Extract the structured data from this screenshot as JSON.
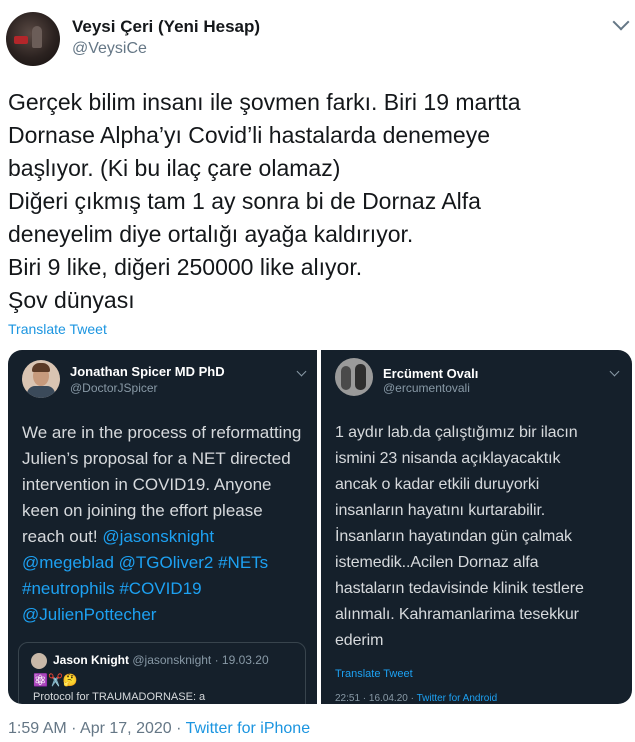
{
  "author": {
    "name": "Veysi Çeri (Yeni Hesap)",
    "handle": "@VeysiCe"
  },
  "tweet": {
    "lines": [
      "Gerçek bilim insanı ile şovmen farkı. Biri 19 martta",
      "Dornase Alpha’yı Covid’li hastalarda denemeye",
      "başlıyor. (Ki bu ilaç çare olamaz)",
      "Diğeri çıkmış tam 1 ay sonra bi de Dornaz Alfa",
      "deneyelim diye ortalığı ayağa kaldırıyor.",
      "Biri 9 like, diğeri 250000 like alıyor.",
      "Şov dünyası"
    ],
    "translate_label": "Translate Tweet"
  },
  "left_tweet": {
    "name": "Jonathan Spicer MD PhD",
    "handle": "@DoctorJSpicer",
    "lines": [
      "We are in the process of reformatting",
      "Julien’s proposal for a NET directed",
      "intervention in COVID19. Anyone",
      "keen on joining the effort please",
      "reach out!",
      "@jasonsknight",
      "@megeblad @TGOliver2 #NETs",
      "#neutrophils #COVID19",
      "@JulienPottecher"
    ],
    "quote": {
      "name": "Jason Knight",
      "handle": "@jasonsknight · 19.03.20",
      "emoji": "⚛️✂️🤔",
      "text": "Protocol for TRAUMADORNASE: a"
    }
  },
  "right_tweet": {
    "name": "Ercüment Ovalı",
    "handle": "@ercumentovali",
    "lines": [
      "1 aydır lab.da çalıştığımız bir ilacın",
      "ismini 23 nisanda açıklayacaktık",
      "ancak o kadar etkili duruyorki",
      "insanların hayatını kurtarabilir.",
      "İnsanların hayatından gün çalmak",
      "istemedik..Acilen Dornaz alfa",
      "hastaların tedavisinde klinik testlere",
      "alınmalı. Kahramanlarima tesekkur",
      "ederim"
    ],
    "translate_label": "Translate Tweet",
    "footer_time": "22:51 · 16.04.20 ·",
    "footer_client": "Twitter for Android"
  },
  "footer": {
    "timestamp": "1:59 AM · Apr 17, 2020 ·",
    "client": "Twitter for iPhone"
  },
  "colors": {
    "link": "#1b95e0",
    "dark_panel": "#15202b",
    "secondary_text": "#657786"
  }
}
